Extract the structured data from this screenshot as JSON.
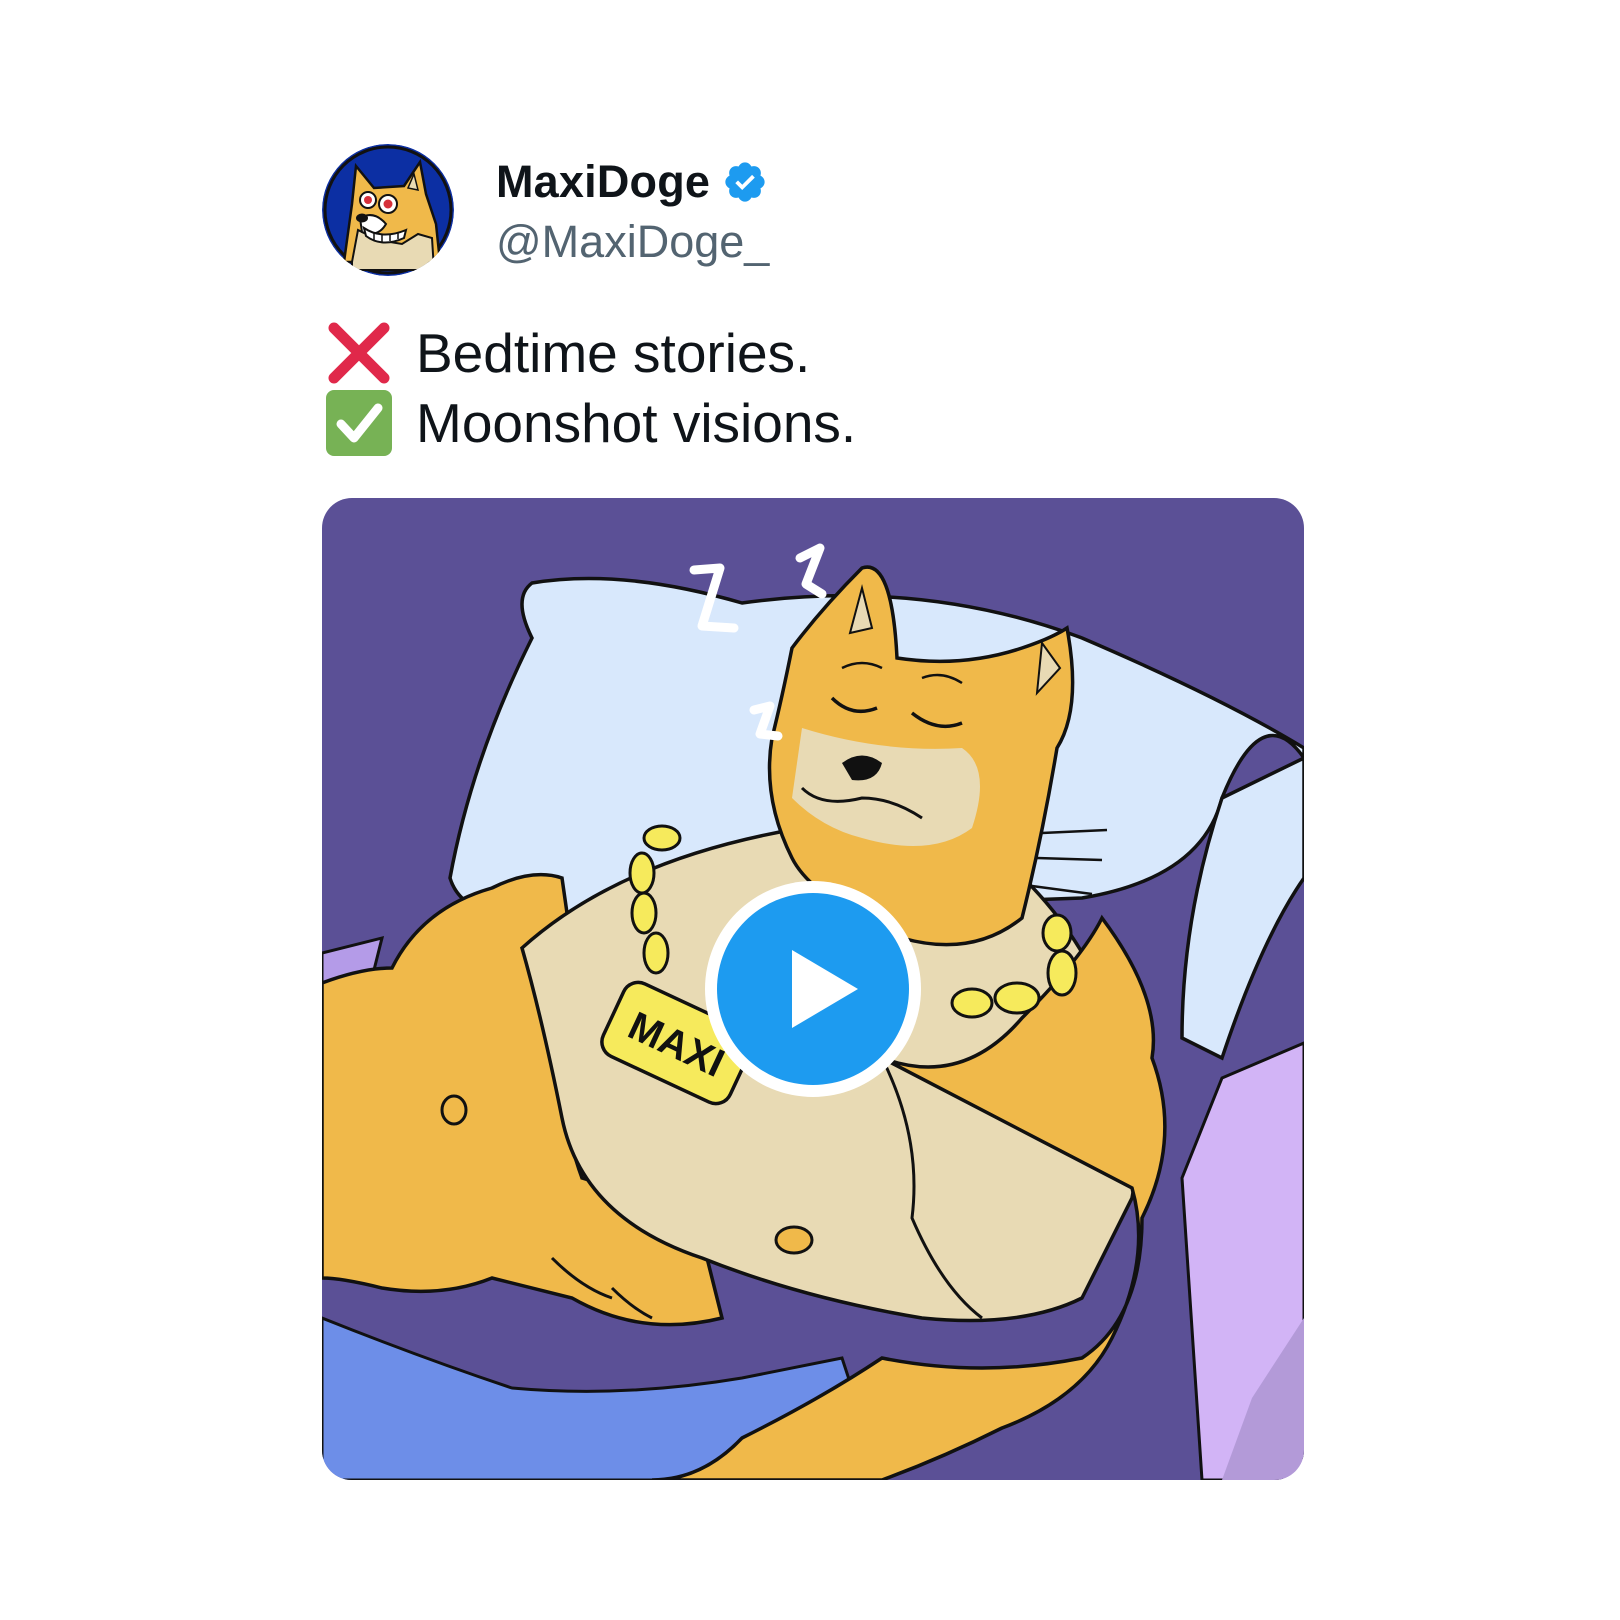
{
  "author": {
    "display_name": "MaxiDoge",
    "handle": "@MaxiDoge_",
    "verified": true,
    "avatar_icon": "shiba-doge-avatar"
  },
  "tweet": {
    "lines": [
      {
        "icon": "cross-mark-icon",
        "text": "Bedtime stories."
      },
      {
        "icon": "check-mark-button-icon",
        "text": "Moonshot visions."
      }
    ]
  },
  "media": {
    "type": "video",
    "play_icon": "play-icon",
    "pendant_text": "MAXI",
    "sleep_text": "Z"
  },
  "colors": {
    "verified_blue": "#1d9bf0",
    "play_blue": "#1d9bf0",
    "background_purple": "#5b5096",
    "pillow": "#d8e8fc",
    "fur": "#f0b94a",
    "cream": "#e8dab4",
    "chain_gold": "#f6ea5c",
    "blanket_blue": "#6d8ee8",
    "blanket_lavender": "#d2b4f6",
    "cross_red": "#e0284a",
    "check_green": "#77b255",
    "text_primary": "#0f1419",
    "text_secondary": "#536471"
  }
}
